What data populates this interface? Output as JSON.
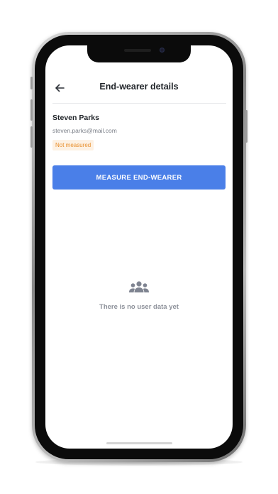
{
  "header": {
    "title": "End-wearer details",
    "back_icon": "arrow-left-icon"
  },
  "user": {
    "name": "Steven Parks",
    "email": "steven.parks@mail.com",
    "status": "Not measured"
  },
  "actions": {
    "measure_label": "MEASURE END-WEARER"
  },
  "empty_state": {
    "icon": "users-group-icon",
    "message": "There is no user data yet"
  },
  "colors": {
    "primary": "#4a7fe8",
    "status_text": "#e88f2d",
    "status_bg": "#fdf1e3",
    "muted_text": "#8c9099"
  }
}
